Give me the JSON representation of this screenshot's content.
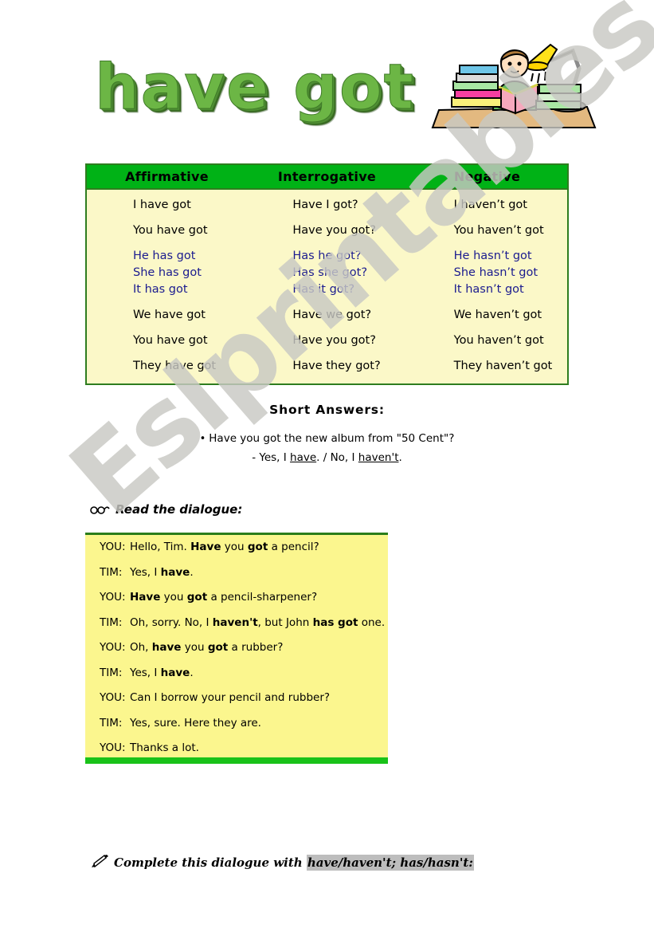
{
  "title": "have got",
  "clipart": {
    "name": "boy-reading-at-desk-clipart",
    "alt": "Boy reading a book at a desk with a stack of books and a desk lamp"
  },
  "watermark": {
    "text": "Eslprintables.com",
    "color": "#c9c9c4"
  },
  "colors": {
    "header_green": "#00b216",
    "border_green": "#2e7d1f",
    "table_yellow": "#fbf8c8",
    "dialogue_yellow": "#fbf68e",
    "blue_text": "#1b1b8f",
    "title_green": "#6cb645",
    "highlight_gray": "#bdbdbd"
  },
  "table": {
    "headers": [
      "Affirmative",
      "Interrogative",
      "Negative"
    ],
    "groups": [
      {
        "color": "black",
        "rows": [
          [
            "I have got",
            "Have I got?",
            "I haven’t got"
          ]
        ]
      },
      {
        "color": "black",
        "rows": [
          [
            "You have got",
            "Have you got?",
            "You haven’t got"
          ]
        ]
      },
      {
        "color": "blue",
        "rows": [
          [
            "He has got",
            "Has he got?",
            "He hasn’t got"
          ],
          [
            "She has got",
            "Has she got?",
            "She hasn’t got"
          ],
          [
            "It has got",
            "Has it got?",
            "It hasn’t got"
          ]
        ]
      },
      {
        "color": "black",
        "rows": [
          [
            "We have got",
            "Have we got?",
            "We haven’t got"
          ]
        ]
      },
      {
        "color": "black",
        "rows": [
          [
            "You have got",
            "Have you got?",
            "You haven’t got"
          ]
        ]
      },
      {
        "color": "black",
        "rows": [
          [
            "They have got",
            "Have they got?",
            "They haven’t got"
          ]
        ]
      }
    ]
  },
  "short_answers": {
    "title": "Short  Answers:",
    "bullet": "•",
    "question": "Have you got the new album from \"50 Cent\"?",
    "answer_prefix": "- Yes, I ",
    "answer_word_1": "have",
    "answer_middle": ". / No, I ",
    "answer_word_2": "haven't",
    "answer_suffix": "."
  },
  "read_dialogue": {
    "icon": "glasses-icon",
    "label": "Read the dialogue:"
  },
  "dialogue": {
    "lines": [
      {
        "speaker": "YOU:",
        "parts": [
          {
            "t": "Hello, Tim. ",
            "b": false
          },
          {
            "t": "Have",
            "b": true
          },
          {
            "t": " you ",
            "b": false
          },
          {
            "t": "got",
            "b": true
          },
          {
            "t": " a pencil?",
            "b": false
          }
        ]
      },
      {
        "speaker": "TIM:",
        "parts": [
          {
            "t": "Yes, I ",
            "b": false
          },
          {
            "t": "have",
            "b": true
          },
          {
            "t": ".",
            "b": false
          }
        ]
      },
      {
        "speaker": "YOU:",
        "parts": [
          {
            "t": "Have",
            "b": true
          },
          {
            "t": " you ",
            "b": false
          },
          {
            "t": "got",
            "b": true
          },
          {
            "t": " a pencil-sharpener?",
            "b": false
          }
        ]
      },
      {
        "speaker": "TIM:",
        "parts": [
          {
            "t": "Oh, sorry. No, I ",
            "b": false
          },
          {
            "t": "haven't",
            "b": true
          },
          {
            "t": ", but John ",
            "b": false
          },
          {
            "t": "has got",
            "b": true
          },
          {
            "t": " one.",
            "b": false
          }
        ]
      },
      {
        "speaker": "YOU:",
        "parts": [
          {
            "t": "Oh, ",
            "b": false
          },
          {
            "t": "have",
            "b": true
          },
          {
            "t": " you ",
            "b": false
          },
          {
            "t": "got",
            "b": true
          },
          {
            "t": " a rubber?",
            "b": false
          }
        ]
      },
      {
        "speaker": "TIM:",
        "parts": [
          {
            "t": "Yes, I ",
            "b": false
          },
          {
            "t": "have",
            "b": true
          },
          {
            "t": ".",
            "b": false
          }
        ]
      },
      {
        "speaker": "YOU:",
        "parts": [
          {
            "t": "Can I borrow your pencil and rubber?",
            "b": false
          }
        ]
      },
      {
        "speaker": "TIM:",
        "parts": [
          {
            "t": "Yes, sure. Here they are.",
            "b": false
          }
        ]
      },
      {
        "speaker": "YOU:",
        "parts": [
          {
            "t": "Thanks a lot.",
            "b": false
          }
        ]
      }
    ]
  },
  "complete_task": {
    "icon": "pencil-icon",
    "label": "Complete this dialogue with ",
    "highlighted": "have/haven't; has/hasn't:"
  }
}
